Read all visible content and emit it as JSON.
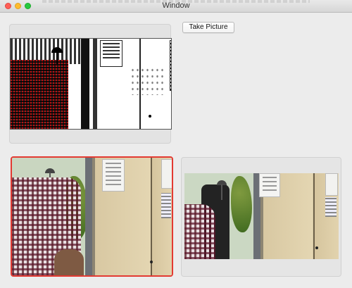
{
  "window": {
    "title": "Window"
  },
  "toolbar": {
    "take_picture_label": "Take Picture"
  },
  "views": [
    {
      "id": "threshold-view",
      "selected": false
    },
    {
      "id": "live-camera-view",
      "selected": true
    },
    {
      "id": "captured-picture-view",
      "selected": false
    }
  ],
  "colors": {
    "selection_border": "#e33a32",
    "window_background": "#ececec"
  },
  "icons": {
    "close": "traffic-light-close-icon",
    "minimize": "traffic-light-minimize-icon",
    "maximize": "traffic-light-maximize-icon"
  }
}
